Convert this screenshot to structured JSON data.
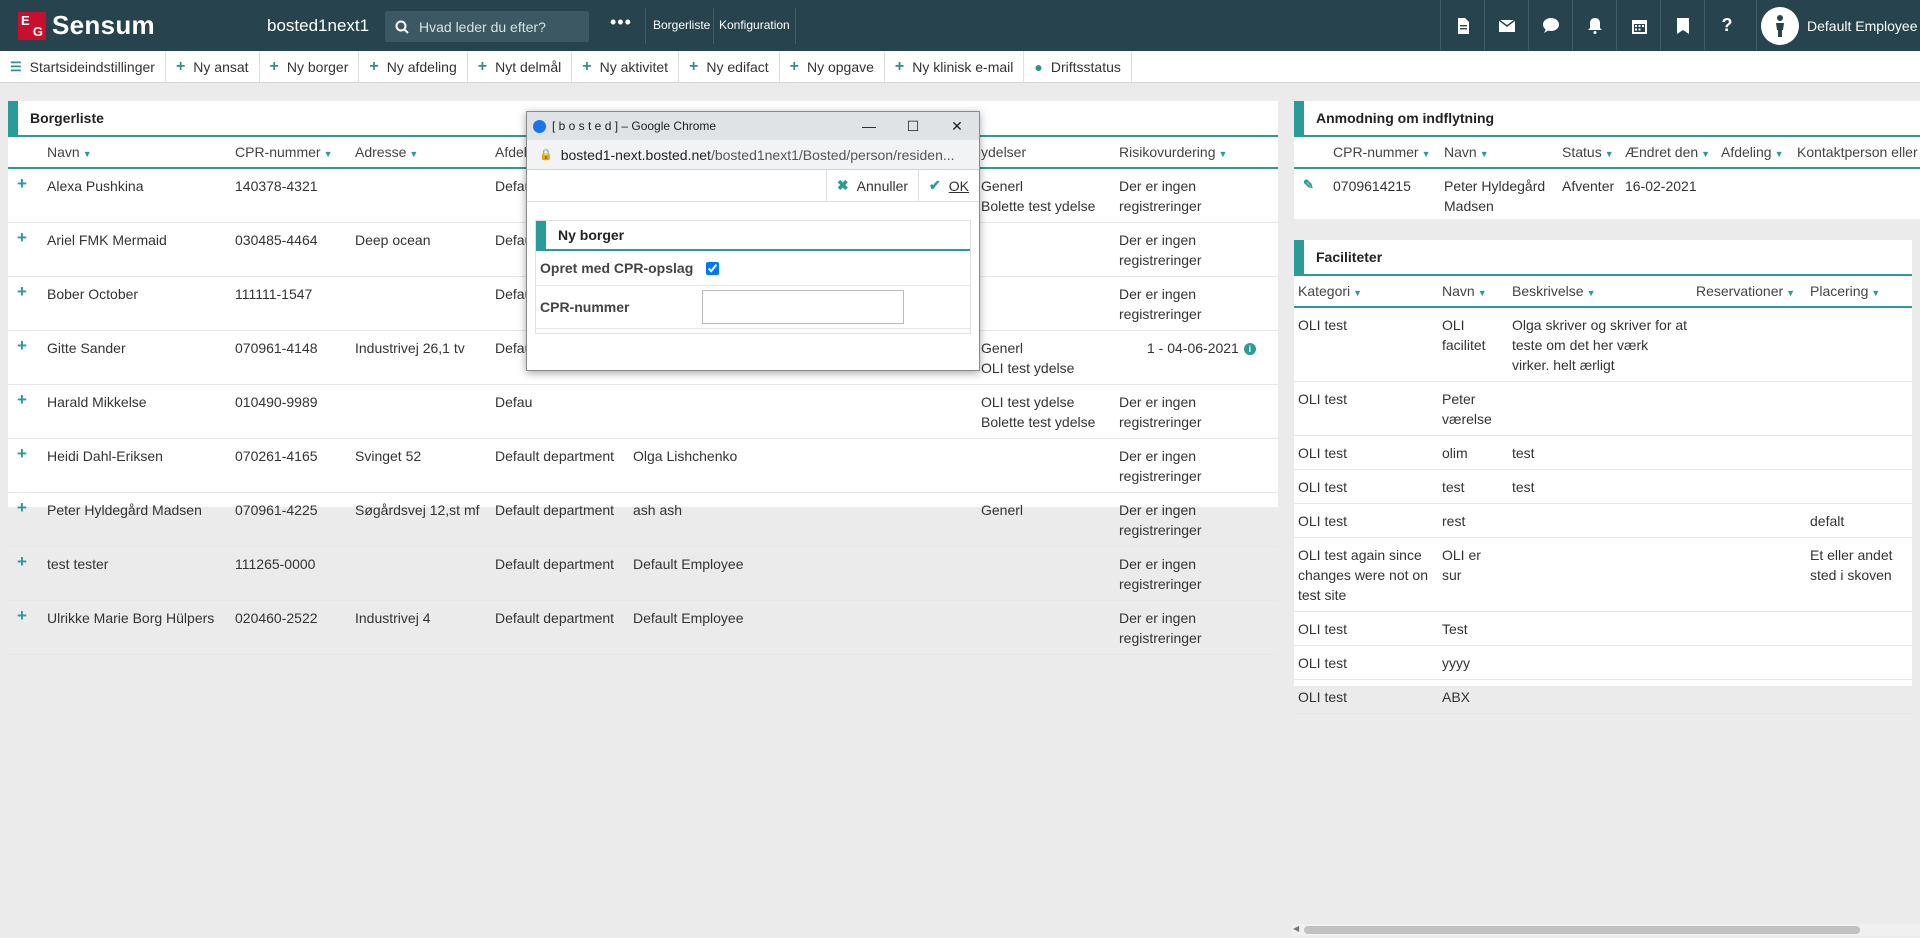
{
  "topbar": {
    "brand": "Sensum",
    "logo_e": "E",
    "logo_g": "G",
    "instance": "bosted1next1",
    "search_placeholder": "Hvad leder du efter?",
    "more": "•••",
    "links": [
      "Borgerliste",
      "Konfiguration"
    ],
    "icons": [
      "document-icon",
      "mail-icon",
      "chat-icon",
      "bell-icon",
      "calendar-icon",
      "bookmark-icon",
      "help-icon"
    ],
    "user": "Default Employee"
  },
  "actions": [
    {
      "icon": "settings-sliders-icon",
      "label": "Startsideindstillinger"
    },
    {
      "icon": "plus-icon",
      "label": "Ny ansat"
    },
    {
      "icon": "plus-icon",
      "label": "Ny borger"
    },
    {
      "icon": "plus-icon",
      "label": "Ny afdeling"
    },
    {
      "icon": "plus-icon",
      "label": "Nyt delmål"
    },
    {
      "icon": "plus-icon",
      "label": "Ny aktivitet"
    },
    {
      "icon": "plus-icon",
      "label": "Ny edifact"
    },
    {
      "icon": "plus-icon",
      "label": "Ny opgave"
    },
    {
      "icon": "plus-icon",
      "label": "Ny klinisk e-mail"
    },
    {
      "icon": "globe-icon",
      "label": "Driftsstatus"
    }
  ],
  "borgerliste": {
    "title": "Borgerliste",
    "columns": [
      "Navn",
      "CPR-nummer",
      "Adresse",
      "Afdeli",
      "",
      "ydelser",
      "Risikovurdering"
    ],
    "rows": [
      {
        "navn": "Alexa Pushkina",
        "cpr": "140378-4321",
        "adresse": "",
        "afd": "Defau",
        "kontakt": "",
        "ydelser": "Generl\nBolette test ydelse",
        "risiko": "Der er ingen registreringer"
      },
      {
        "navn": "Ariel FMK Mermaid",
        "cpr": "030485-4464",
        "adresse": "Deep ocean",
        "afd": "Defau",
        "kontakt": "",
        "ydelser": "",
        "risiko": "Der er ingen registreringer"
      },
      {
        "navn": "Bober October",
        "cpr": "111111-1547",
        "adresse": "",
        "afd": "Defau",
        "kontakt": "",
        "ydelser": "",
        "risiko": "Der er ingen registreringer"
      },
      {
        "navn": "Gitte Sander",
        "cpr": "070961-4148",
        "adresse": "Industrivej 26,1 tv",
        "afd": "Defau",
        "kontakt": "",
        "ydelser": "Generl\nOLI test ydelse",
        "risiko": "1 - 04-06-2021",
        "risiko_info": "i"
      },
      {
        "navn": "Harald Mikkelse",
        "cpr": "010490-9989",
        "adresse": "",
        "afd": "Defau",
        "kontakt": "",
        "ydelser": "OLI test ydelse\nBolette test ydelse",
        "risiko": "Der er ingen registreringer"
      },
      {
        "navn": "Heidi Dahl-Eriksen",
        "cpr": "070261-4165",
        "adresse": "Svinget 52",
        "afd": "Default department",
        "kontakt": "Olga Lishchenko",
        "ydelser": "",
        "risiko": "Der er ingen registreringer"
      },
      {
        "navn": "Peter Hyldegård Madsen",
        "cpr": "070961-4225",
        "adresse": "Søgårdsvej 12,st mf",
        "afd": "Default department",
        "kontakt": "ash ash",
        "ydelser": "Generl",
        "risiko": "Der er ingen registreringer"
      },
      {
        "navn": "test tester",
        "cpr": "111265-0000",
        "adresse": "",
        "afd": "Default department",
        "kontakt": "Default Employee",
        "ydelser": "",
        "risiko": "Der er ingen registreringer"
      },
      {
        "navn": "Ulrikke Marie Borg Hülpers",
        "cpr": "020460-2522",
        "adresse": "Industrivej 4",
        "afd": "Default department",
        "kontakt": "Default Employee",
        "ydelser": "",
        "risiko": "Der er ingen registreringer"
      }
    ]
  },
  "anmodning": {
    "title": "Anmodning om indflytning",
    "columns": [
      "CPR-nummer",
      "Navn",
      "Status",
      "Ændret den",
      "Afdeling",
      "Kontaktperson eller t"
    ],
    "rows": [
      {
        "cpr": "0709614215",
        "navn": "Peter Hyldegård Madsen",
        "status": "Afventer",
        "dato": "16-02-2021",
        "afd": "",
        "kontakt": ""
      }
    ]
  },
  "faciliteter": {
    "title": "Faciliteter",
    "columns": [
      "Kategori",
      "Navn",
      "Beskrivelse",
      "Reservationer",
      "Placering"
    ],
    "rows": [
      {
        "kategori": "OLI test",
        "navn": "OLI facilitet",
        "beskrivelse": "Olga skriver og skriver for at teste om det her værk virker. helt ærligt",
        "reservationer": "",
        "placering": ""
      },
      {
        "kategori": "OLI test",
        "navn": "Peter værelse",
        "beskrivelse": "",
        "reservationer": "",
        "placering": ""
      },
      {
        "kategori": "OLI test",
        "navn": "olim",
        "beskrivelse": "test",
        "reservationer": "",
        "placering": ""
      },
      {
        "kategori": "OLI test",
        "navn": "test",
        "beskrivelse": "test",
        "reservationer": "",
        "placering": ""
      },
      {
        "kategori": "OLI test",
        "navn": "rest",
        "beskrivelse": "",
        "reservationer": "",
        "placering": "defalt"
      },
      {
        "kategori": "OLI test again since changes were not on test site",
        "navn": "OLI er sur",
        "beskrivelse": "",
        "reservationer": "",
        "placering": "Et eller andet sted i skoven"
      },
      {
        "kategori": "OLI test",
        "navn": "Test",
        "beskrivelse": "",
        "reservationer": "",
        "placering": ""
      },
      {
        "kategori": "OLI test",
        "navn": "yyyy",
        "beskrivelse": "",
        "reservationer": "",
        "placering": ""
      },
      {
        "kategori": "OLI test",
        "navn": "ABX",
        "beskrivelse": "",
        "reservationer": "",
        "placering": ""
      }
    ]
  },
  "dialog": {
    "window_title": "[ b o s t e d ] – Google Chrome",
    "url_host": "bosted1-next.bosted.net",
    "url_path": "/bosted1next1/Bosted/person/residen...",
    "cancel": "Annuller",
    "ok": "OK",
    "form_title": "Ny borger",
    "cpr_lookup_label": "Opret med CPR-opslag",
    "cpr_lookup_checked": true,
    "cpr_label": "CPR-nummer",
    "cpr_value": ""
  },
  "colors": {
    "topbar": "#27444e",
    "accent": "#2a9b98",
    "page_bg": "#ebebeb"
  }
}
